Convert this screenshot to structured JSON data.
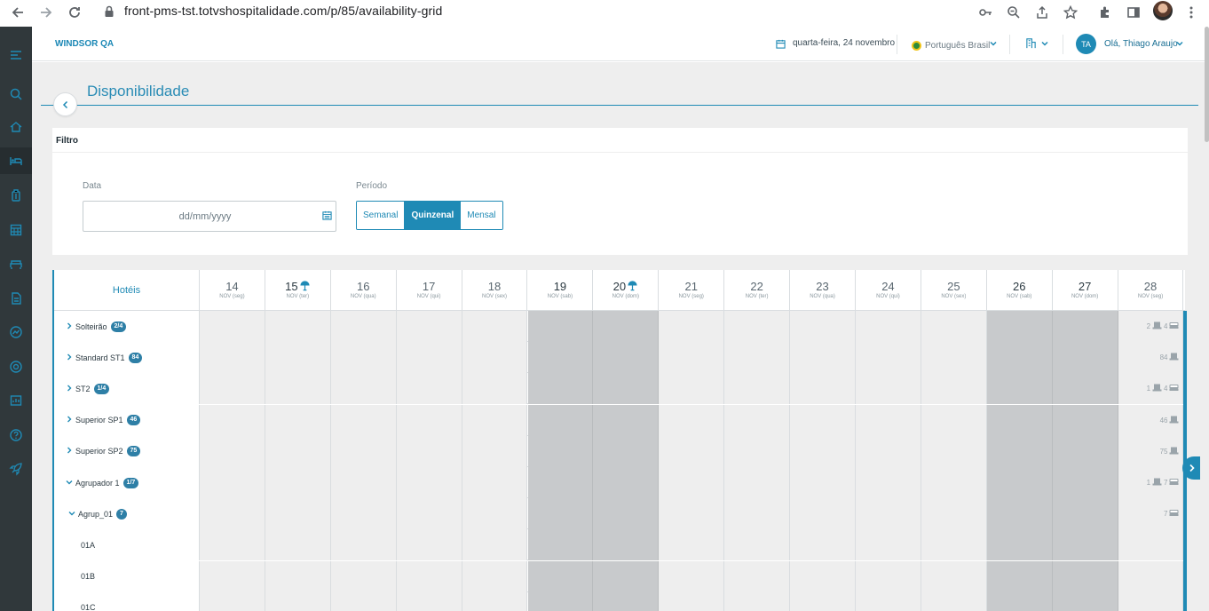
{
  "browser": {
    "url": "front-pms-tst.totvshospitalidade.com/p/85/availability-grid"
  },
  "header": {
    "hotel_name": "WINDSOR QA",
    "date": "quarta-feira, 24 novembro",
    "language": "Português Brasil",
    "user_initials": "TA",
    "user_greeting": "Olá, Thiago Araujo"
  },
  "page": {
    "title": "Disponibilidade"
  },
  "filter": {
    "title": "Filtro",
    "date_label": "Data",
    "date_placeholder": "dd/mm/yyyy",
    "period_label": "Período",
    "period_options": [
      "Semanal",
      "Quinzenal",
      "Mensal"
    ],
    "period_selected": "Quinzenal"
  },
  "grid": {
    "hotels_header": "Hotéis",
    "days": [
      {
        "num": "14",
        "sub": "NOV (seg)",
        "weekend": false,
        "holiday": false
      },
      {
        "num": "15",
        "sub": "NOV (ter)",
        "weekend": false,
        "holiday": true
      },
      {
        "num": "16",
        "sub": "NOV (qua)",
        "weekend": false,
        "holiday": false
      },
      {
        "num": "17",
        "sub": "NOV (qui)",
        "weekend": false,
        "holiday": false
      },
      {
        "num": "18",
        "sub": "NOV (sex)",
        "weekend": false,
        "holiday": false
      },
      {
        "num": "19",
        "sub": "NOV (sab)",
        "weekend": true,
        "holiday": false
      },
      {
        "num": "20",
        "sub": "NOV (dom)",
        "weekend": true,
        "holiday": true
      },
      {
        "num": "21",
        "sub": "NOV (seg)",
        "weekend": false,
        "holiday": false
      },
      {
        "num": "22",
        "sub": "NOV (ter)",
        "weekend": false,
        "holiday": false
      },
      {
        "num": "23",
        "sub": "NOV (qua)",
        "weekend": false,
        "holiday": false
      },
      {
        "num": "24",
        "sub": "NOV (qui)",
        "weekend": false,
        "holiday": false
      },
      {
        "num": "25",
        "sub": "NOV (sex)",
        "weekend": false,
        "holiday": false
      },
      {
        "num": "26",
        "sub": "NOV (sab)",
        "weekend": true,
        "holiday": false
      },
      {
        "num": "27",
        "sub": "NOV (dom)",
        "weekend": true,
        "holiday": false
      },
      {
        "num": "28",
        "sub": "NOV (seg)",
        "weekend": false,
        "holiday": false
      }
    ],
    "rows": [
      {
        "label": "Solteirão",
        "badge": "2/4",
        "chevron": "right",
        "indent": 0,
        "avail": [
          "2",
          "4"
        ],
        "icons": [
          "room-icon",
          "bed-icon"
        ]
      },
      {
        "label": "Standard ST1",
        "badge": "84",
        "chevron": "right",
        "indent": 0,
        "avail": [
          "84"
        ],
        "icons": [
          "room-icon"
        ]
      },
      {
        "label": "ST2",
        "badge": "1/4",
        "chevron": "right",
        "indent": 0,
        "avail": [
          "1",
          "4"
        ],
        "icons": [
          "room-icon",
          "bed-icon"
        ]
      },
      {
        "label": "Superior SP1",
        "badge": "46",
        "chevron": "right",
        "indent": 0,
        "avail": [
          "46"
        ],
        "icons": [
          "room-icon"
        ]
      },
      {
        "label": "Superior SP2",
        "badge": "75",
        "chevron": "right",
        "indent": 0,
        "avail": [
          "75"
        ],
        "icons": [
          "room-icon"
        ]
      },
      {
        "label": "Agrupador 1",
        "badge": "1/7",
        "chevron": "down",
        "indent": 0,
        "avail": [
          "1",
          "7"
        ],
        "icons": [
          "room-icon",
          "bed-icon"
        ]
      },
      {
        "label": "Agrup_01",
        "badge": "7",
        "chevron": "down",
        "indent": 1,
        "avail": [
          "7"
        ],
        "icons": [
          "bed-icon"
        ]
      },
      {
        "label": "01A",
        "badge": "",
        "chevron": "",
        "indent": 2,
        "avail": [],
        "icons": []
      },
      {
        "label": "01B",
        "badge": "",
        "chevron": "",
        "indent": 2,
        "avail": [],
        "icons": []
      },
      {
        "label": "01C",
        "badge": "",
        "chevron": "",
        "indent": 2,
        "avail": [],
        "icons": []
      }
    ]
  },
  "colors": {
    "accent": "#1f8ab5",
    "sidebar": "#30383b",
    "weekend": "#c8cacc",
    "cell": "#eeeeee"
  }
}
